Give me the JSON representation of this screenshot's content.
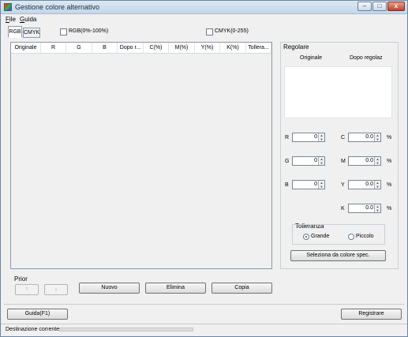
{
  "window": {
    "title": "Gestione colore alternativo"
  },
  "menu": [
    {
      "label": "File",
      "key": "F",
      "rest": "ile"
    },
    {
      "label": "Guida",
      "key": "G",
      "rest": "uida"
    }
  ],
  "tabs": [
    {
      "label": "RGB",
      "active": true
    },
    {
      "label": "CMYK",
      "active": false
    }
  ],
  "options": {
    "rgb_percent": {
      "label": "RGB(0%-100%)",
      "checked": false
    },
    "cmyk_range": {
      "label": "CMYK(0-255)",
      "checked": false
    }
  },
  "table": {
    "columns": [
      "Originale",
      "R",
      "G",
      "B",
      "Dopo r...",
      "C(%)",
      "M(%)",
      "Y(%)",
      "K(%)",
      "Tollera..."
    ],
    "rows": []
  },
  "adjust": {
    "title": "Regolare",
    "original_label": "Originale",
    "after_label": "Dopo regolaz",
    "rgb": [
      {
        "label": "R",
        "value": "0"
      },
      {
        "label": "G",
        "value": "0"
      },
      {
        "label": "B",
        "value": "0"
      }
    ],
    "cmyk": [
      {
        "label": "C",
        "value": "0.0"
      },
      {
        "label": "M",
        "value": "0.0"
      },
      {
        "label": "Y",
        "value": "0.0"
      },
      {
        "label": "K",
        "value": "0.0"
      }
    ],
    "unit": "%",
    "tolerance": {
      "title": "Tolleranza",
      "options": [
        {
          "label": "Grande",
          "selected": true
        },
        {
          "label": "Piccolo",
          "selected": false
        }
      ]
    },
    "select_spec_button": "Seleziona da colore spec."
  },
  "priority": {
    "label": "Prior",
    "up": "↑",
    "down": "↓"
  },
  "actions": {
    "new": "Nuovo",
    "delete": "Elimina",
    "copy": "Copia"
  },
  "footer": {
    "help": "Guida(F1)",
    "register": "Registrare"
  },
  "status": {
    "text": "Destinazione corrente"
  },
  "controls": {
    "minimize": "–",
    "maximize": "□",
    "close": "x"
  }
}
